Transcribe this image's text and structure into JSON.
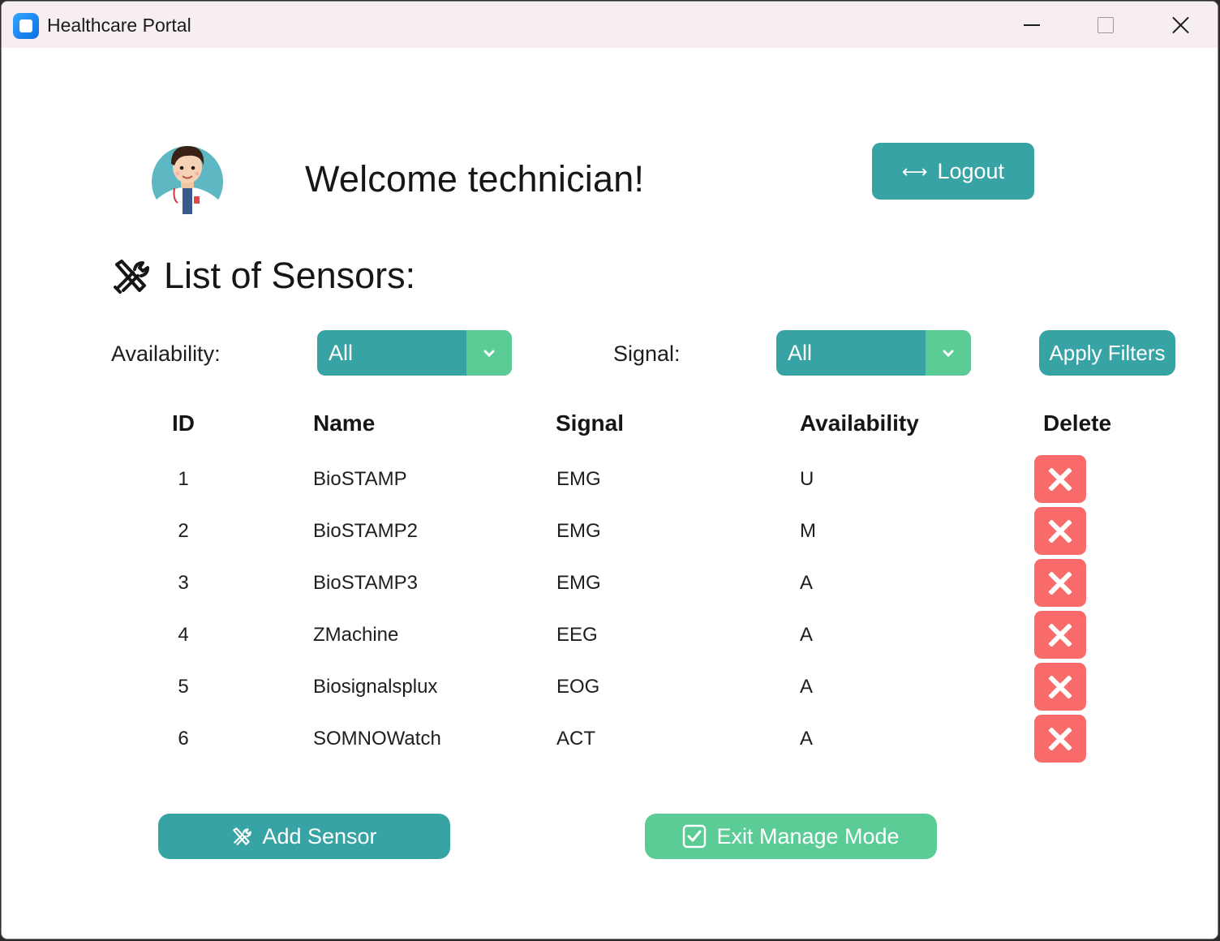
{
  "window": {
    "title": "Healthcare Portal",
    "icon": "app-icon",
    "controls": [
      "minimize-icon",
      "maximize-icon",
      "close-icon"
    ]
  },
  "header": {
    "welcome": "Welcome technician!",
    "avatar_icon": "doctor-avatar-icon",
    "logout_label": "Logout",
    "logout_icon": "⟷"
  },
  "section": {
    "title": "List of Sensors:",
    "icon": "tools-icon"
  },
  "filters": {
    "availability_label": "Availability:",
    "availability_value": "All",
    "signal_label": "Signal:",
    "signal_value": "All",
    "apply_label": "Apply Filters"
  },
  "table": {
    "headers": [
      "ID",
      "Name",
      "Signal",
      "Availability",
      "Delete"
    ],
    "rows": [
      {
        "id": "1",
        "name": "BioSTAMP",
        "signal": "EMG",
        "availability": "U"
      },
      {
        "id": "2",
        "name": "BioSTAMP2",
        "signal": "EMG",
        "availability": "M"
      },
      {
        "id": "3",
        "name": "BioSTAMP3",
        "signal": "EMG",
        "availability": "A"
      },
      {
        "id": "4",
        "name": "ZMachine",
        "signal": "EEG",
        "availability": "A"
      },
      {
        "id": "5",
        "name": "Biosignalsplux",
        "signal": "EOG",
        "availability": "A"
      },
      {
        "id": "6",
        "name": "SOMNOWatch",
        "signal": "ACT",
        "availability": "A"
      }
    ]
  },
  "actions": {
    "add_label": "Add Sensor",
    "exit_label": "Exit Manage Mode"
  },
  "colors": {
    "teal": "#38a3a5",
    "green": "#5ccc96",
    "delete_red": "#f96a6a"
  }
}
